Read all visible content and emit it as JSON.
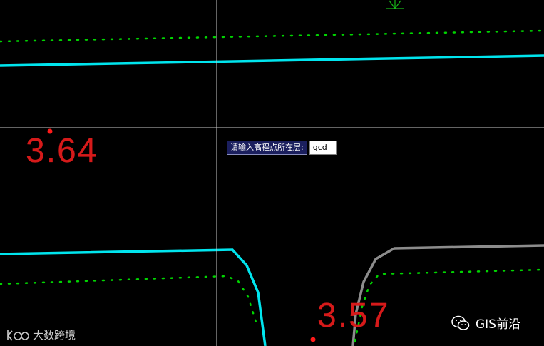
{
  "drawing": {
    "elevation_labels": [
      "3.64",
      "3.57"
    ],
    "colors": {
      "road_edge": "#00e5ee",
      "dotted_line": "#00d400",
      "curb": "#8c8c8c",
      "elevation_text": "#d61a1a",
      "elevation_point": "#ff1a1a",
      "crosshair": "#c8c8c8",
      "tree_symbol": "#18b818"
    }
  },
  "command_prompt": {
    "label": "请输入高程点所在层:",
    "input_value": "gcd"
  },
  "watermarks": {
    "left_text": "大数跨境",
    "right_text": "GIS前沿",
    "left_icon": "kuo-logo-icon",
    "right_icon": "wechat-icon"
  }
}
